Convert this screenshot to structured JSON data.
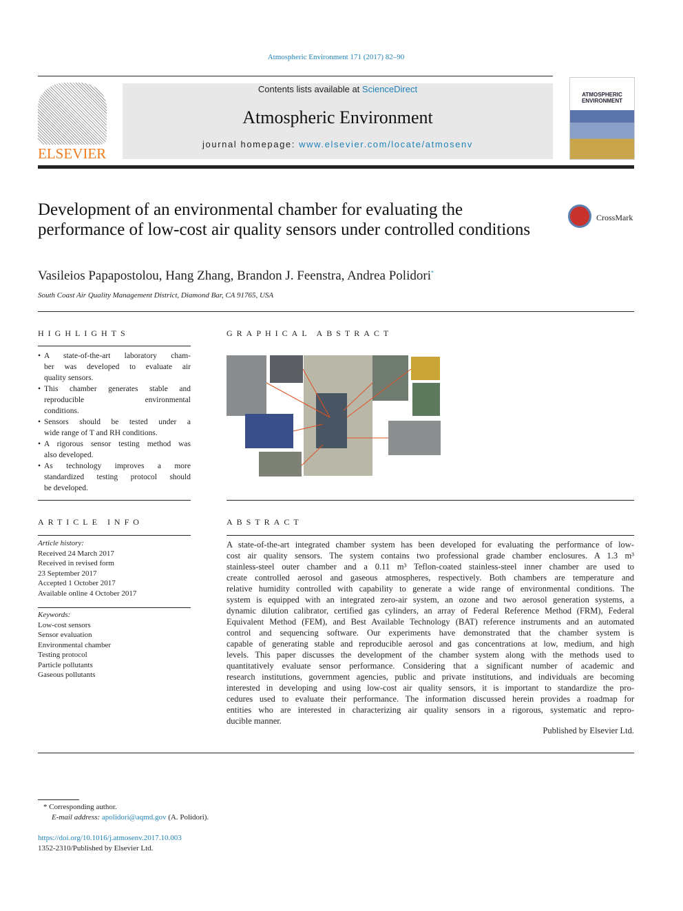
{
  "header": {
    "citation": "Atmospheric Environment 171 (2017) 82–90",
    "contents_prefix": "Contents lists available at ",
    "contents_link": "ScienceDirect",
    "journal_title": "Atmospheric Environment",
    "homepage_prefix": "journal homepage: ",
    "homepage_link": "www.elsevier.com/locate/atmosenv",
    "publisher_logo": "ELSEVIER",
    "cover_title_1": "ATMOSPHERIC",
    "cover_title_2": "ENVIRONMENT"
  },
  "article": {
    "title": "Development of an environmental chamber for evaluating the performance of low-cost air quality sensors under controlled conditions",
    "authors": "Vasileios Papapostolou, Hang Zhang, Brandon J. Feenstra, Andrea Polidori",
    "author_mark": "*",
    "affiliation": "South Coast Air Quality Management District, Diamond Bar, CA 91765, USA",
    "crossmark": "CrossMark"
  },
  "highlights": {
    "heading": "HIGHLIGHTS",
    "items": [
      [
        "A state-of-the-art laboratory cham-",
        "ber was developed to evaluate air",
        "quality sensors."
      ],
      [
        "This chamber generates stable and",
        "reproducible environmental",
        "conditions."
      ],
      [
        "Sensors should be tested under a",
        "wide range of T and RH conditions."
      ],
      [
        "A rigorous sensor testing method was",
        "also developed."
      ],
      [
        "As technology improves a more",
        "standardized testing protocol should",
        "be developed."
      ]
    ]
  },
  "graphical_abstract": {
    "heading": "GRAPHICAL ABSTRACT"
  },
  "article_info": {
    "heading": "ARTICLE INFO",
    "history_label": "Article history:",
    "history": [
      "Received 24 March 2017",
      "Received in revised form",
      "23 September 2017",
      "Accepted 1 October 2017",
      "Available online 4 October 2017"
    ],
    "keywords_label": "Keywords:",
    "keywords": [
      "Low-cost sensors",
      "Sensor evaluation",
      "Environmental chamber",
      "Testing protocol",
      "Particle pollutants",
      "Gaseous pollutants"
    ]
  },
  "abstract": {
    "heading": "ABSTRACT",
    "lines": [
      "A state-of-the-art integrated chamber system has been developed for evaluating the performance of low-",
      "cost air quality sensors. The system contains two professional grade chamber enclosures. A 1.3 m³",
      "stainless-steel outer chamber and a 0.11 m³ Teflon-coated stainless-steel inner chamber are used to",
      "create controlled aerosol and gaseous atmospheres, respectively. Both chambers are temperature and",
      "relative humidity controlled with capability to generate a wide range of environmental conditions. The",
      "system is equipped with an integrated zero-air system, an ozone and two aerosol generation systems, a",
      "dynamic dilution calibrator, certified gas cylinders, an array of Federal Reference Method (FRM), Federal",
      "Equivalent Method (FEM), and Best Available Technology (BAT) reference instruments and an automated",
      "control and sequencing software. Our experiments have demonstrated that the chamber system is",
      "capable of generating stable and reproducible aerosol and gas concentrations at low, medium, and high",
      "levels. This paper discusses the development of the chamber system along with the methods used to",
      "quantitatively evaluate sensor performance. Considering that a significant number of academic and",
      "research institutions, government agencies, public and private institutions, and individuals are becoming",
      "interested in developing and using low-cost air quality sensors, it is important to standardize the pro-",
      "cedures used to evaluate their performance. The information discussed herein provides a roadmap for",
      "entities who are interested in characterizing air quality sensors in a rigorous, systematic and repro-",
      "ducible manner."
    ],
    "published": "Published by Elsevier Ltd."
  },
  "footer": {
    "mark": "*",
    "corresponding": "Corresponding author.",
    "email_label": "E-mail address:",
    "email": "apolidori@aqmd.gov",
    "email_name": "(A. Polidori).",
    "doi": "https://doi.org/10.1016/j.atmosenv.2017.10.003",
    "issn": "1352-2310/Published by Elsevier Ltd."
  }
}
